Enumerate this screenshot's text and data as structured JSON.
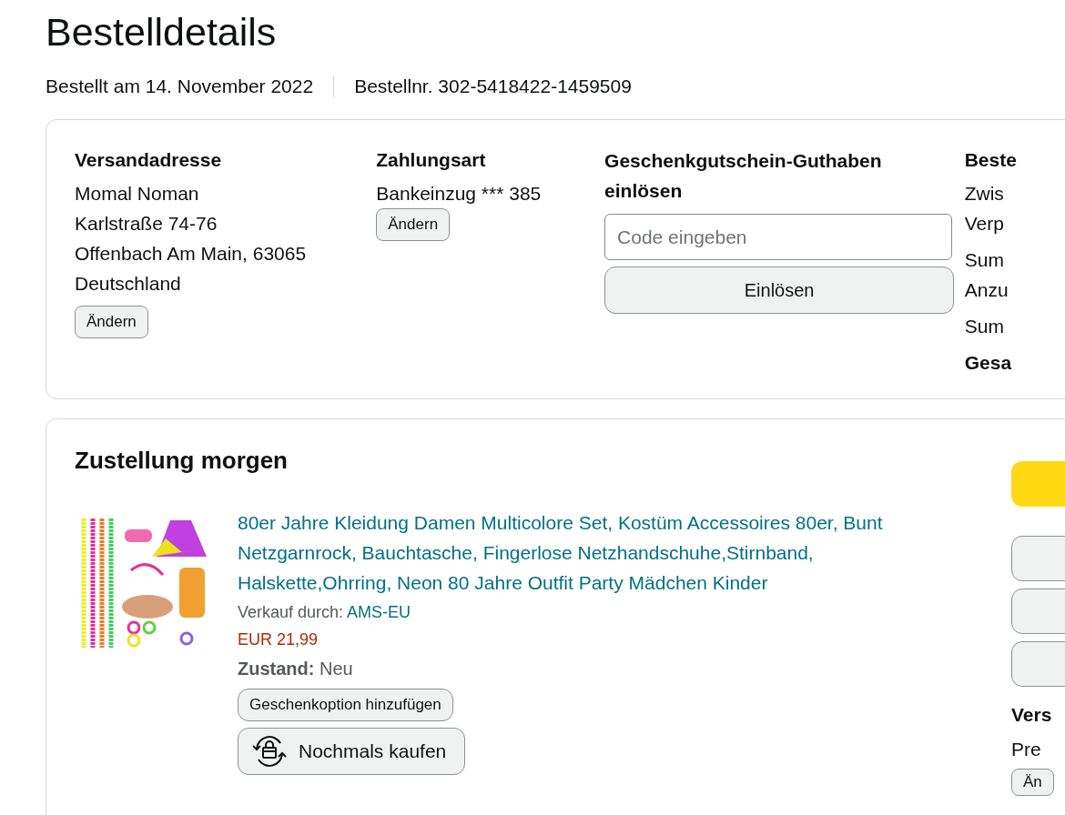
{
  "page_title": "Bestelldetails",
  "order_meta": [
    "Bestellt am 14. November 2022",
    "Bestellnr. 302-5418422-1459509"
  ],
  "shipping_address": {
    "heading": "Versandadresse",
    "lines": [
      "Momal Noman",
      "Karlstraße 74-76",
      "Offenbach Am Main, 63065",
      "Deutschland"
    ],
    "button": "Ändern"
  },
  "payment": {
    "heading": "Zahlungsart",
    "method": "Bankeinzug *** 385",
    "button": "Ändern"
  },
  "gift_card": {
    "heading": "Geschenkgutschein-Guthaben einlösen",
    "placeholder": "Code eingeben",
    "button": "Einlösen"
  },
  "summary": {
    "heading": "Beste",
    "groups": [
      [
        "Zwis",
        "Verp"
      ],
      [
        "Sum",
        "Anzu"
      ],
      [
        "Sum"
      ]
    ],
    "total": "Gesa"
  },
  "delivery": {
    "heading": "Zustellung morgen",
    "item": {
      "title": "80er Jahre Kleidung Damen Multicolore Set, Kostüm Accessoires 80er, Bunt Netzgarnrock, Bauchtasche, Fingerlose Netzhandschuhe,Stirnband, Halskette,Ohrring, Neon 80 Jahre Outfit Party Mädchen Kinder",
      "seller_label": "Verkauf durch:",
      "seller": "AMS-EU",
      "price": "EUR 21,99",
      "condition_label": "Zustand:",
      "condition": "Neu",
      "gift_button": "Geschenkoption hinzufügen",
      "buy_again_button": "Nochmals kaufen"
    },
    "side_buttons": [
      {
        "kind": "primary"
      },
      {
        "kind": "secondary"
      },
      {
        "kind": "secondary"
      },
      {
        "kind": "secondary"
      }
    ],
    "shipping_heading": "Vers",
    "shipping_speed": "Pre",
    "change_button": "Än"
  }
}
